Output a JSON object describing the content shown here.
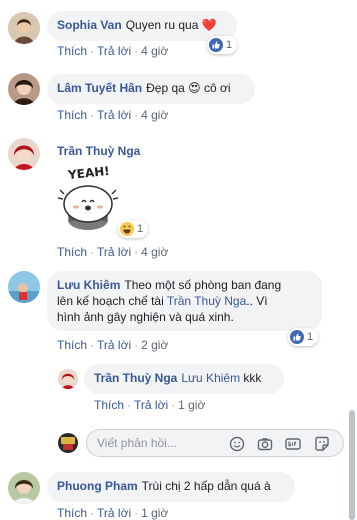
{
  "actions": {
    "like": "Thích",
    "reply": "Trả lời"
  },
  "comments": [
    {
      "name": "Sophia Van",
      "text": "Quyen ru qua",
      "emoji": "❤️",
      "time": "4 giờ",
      "reaction_count": "1"
    },
    {
      "name": "Lâm Tuyết Hân",
      "text": "Đẹp qa",
      "emoji": "😍",
      "text_after": "cô ơi",
      "time": "4 giờ"
    },
    {
      "name": "Trần Thuỳ Nga",
      "sticker_text": "YEAH!",
      "time": "4 giờ",
      "reaction_count": "1"
    },
    {
      "name": "Lưu Khiêm",
      "text_line1": "Theo một số phòng ban đang",
      "text_line2_prefix": "lên kế hoạch chế tài",
      "mention": "Trần Thuỳ Nga",
      "text_line2_suffix": ".. Vì",
      "text_line3": "hình ảnh gây nghiện và quá xinh.",
      "time": "2 giờ",
      "reaction_count": "1"
    },
    {
      "name": "Phuong Pham",
      "text": "Trùi chị 2 hấp dẫn quá à",
      "time": "1 giờ"
    }
  ],
  "reply": {
    "name": "Trần Thuỳ Nga",
    "mention": "Lưu Khiêm",
    "text": "kkk",
    "time": "1 giờ"
  },
  "composer": {
    "placeholder": "Viết phản hồi..."
  },
  "colors": {
    "link": "#385898",
    "bubble": "#f2f3f5",
    "like_blue": "#4267b2"
  }
}
